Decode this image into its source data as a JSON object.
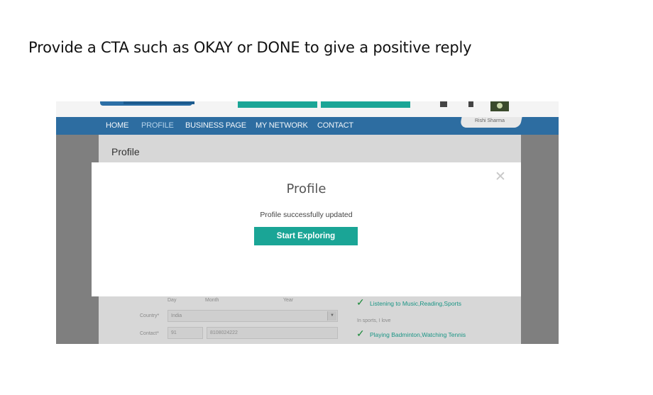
{
  "slide": {
    "caption": "Provide a CTA such as OKAY or DONE to give a positive reply"
  },
  "colors": {
    "nav": "#2d6da1",
    "accent": "#1aa596",
    "overlay": "#7f7f7f",
    "check": "#1b8a3a"
  },
  "nav": {
    "items": [
      "HOME",
      "PROFILE",
      "BUSINESS PAGE",
      "MY NETWORK",
      "CONTACT"
    ],
    "active": "PROFILE",
    "user_name": "Rishi Sharma"
  },
  "page": {
    "title": "Profile"
  },
  "form": {
    "dob_labels": {
      "day": "Day",
      "month": "Month",
      "year": "Year"
    },
    "country": {
      "label": "Country*",
      "value": "India"
    },
    "contact": {
      "label": "Contact*",
      "code": "91",
      "number": "8108024222"
    }
  },
  "interests": {
    "hobbies": "Listening to Music,Reading,Sports",
    "sports_prompt": "In sports, I love",
    "sports": "Playing Badminton,Watching Tennis"
  },
  "modal": {
    "title": "Profile",
    "message": "Profile successfully updated",
    "cta_label": "Start Exploring",
    "close_glyph": "✕"
  },
  "icons": {
    "close": "close-icon",
    "check": "checkmark-icon",
    "dropdown": "chevron-down-icon"
  }
}
